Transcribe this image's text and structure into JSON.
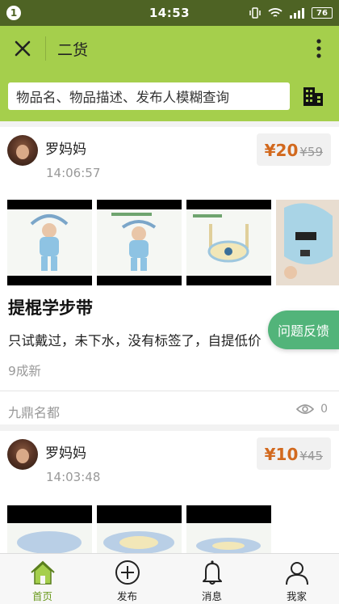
{
  "status_bar": {
    "notification_count": "1",
    "time": "14:53",
    "battery": "76"
  },
  "header": {
    "title": "二货"
  },
  "search": {
    "placeholder": "物品名、物品描述、发布人模糊查询"
  },
  "posts": [
    {
      "user": "罗妈妈",
      "time": "14:06:57",
      "price": "¥20",
      "original_price": "¥59",
      "title": "提棍学步带",
      "description": "只试戴过，未下水，没有标签了，自提低价",
      "condition": "9成新",
      "location": "九鼎名都",
      "views": "0"
    },
    {
      "user": "罗妈妈",
      "time": "14:03:48",
      "price": "¥10",
      "original_price": "¥45"
    }
  ],
  "feedback_label": "问题反馈",
  "bottom_nav": [
    {
      "label": "首页",
      "icon": "home-icon",
      "active": true
    },
    {
      "label": "发布",
      "icon": "add-circle-icon",
      "active": false
    },
    {
      "label": "消息",
      "icon": "bell-icon",
      "active": false
    },
    {
      "label": "我家",
      "icon": "person-icon",
      "active": false
    }
  ],
  "colors": {
    "accent": "#a5cf4c",
    "status_bar": "#4e6324",
    "price": "#d2691e",
    "feedback": "#52b47a",
    "active_nav": "#6a9a1e"
  }
}
